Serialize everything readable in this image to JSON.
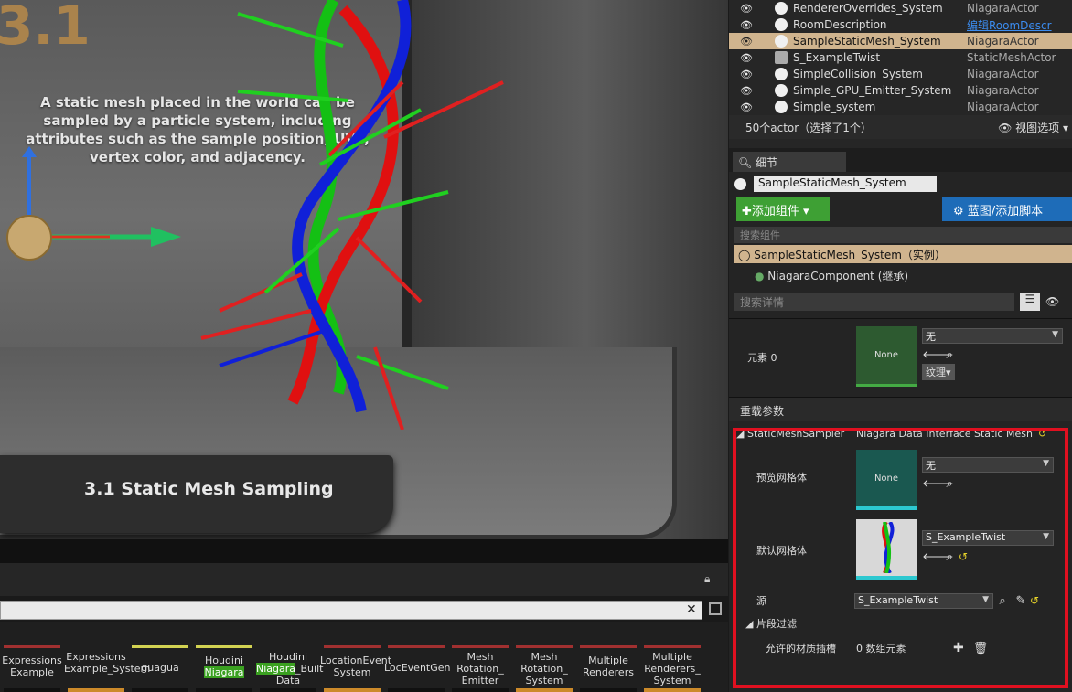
{
  "viewport": {
    "heading": "3.1",
    "description": "A static mesh placed in the world can be sampled by a particle system, including attributes such as the sample position, UVs, vertex color, and adjacency.",
    "plaque": "3.1  Static Mesh Sampling"
  },
  "content_browser": {
    "items": [
      {
        "label": "Expressions Example",
        "highlight": ""
      },
      {
        "label": "Expressions Example_System",
        "highlight": ""
      },
      {
        "label": "guagua",
        "highlight": ""
      },
      {
        "label_a": "Houdini",
        "label_b": "Niagara",
        "highlight": "Niagara"
      },
      {
        "label_a": "Houdini",
        "label_b": "Niagara",
        "label_c": "_Built Data",
        "highlight": "Niagara"
      },
      {
        "label": "LocationEvent System",
        "highlight": ""
      },
      {
        "label": "LocEventGen",
        "highlight": ""
      },
      {
        "label": "Mesh Rotation_ Emitter",
        "highlight": ""
      },
      {
        "label": "Mesh Rotation_ System",
        "highlight": ""
      },
      {
        "label": "Multiple Renderers",
        "highlight": ""
      },
      {
        "label": "Multiple Renderers_ System",
        "highlight": ""
      }
    ]
  },
  "outliner": {
    "rows": [
      {
        "name": "RendererOverrides_System",
        "type": "NiagaraActor",
        "selected": false,
        "link": false
      },
      {
        "name": "RoomDescription",
        "type": "编辑RoomDescr",
        "selected": false,
        "link": true
      },
      {
        "name": "SampleStaticMesh_System",
        "type": "NiagaraActor",
        "selected": true,
        "link": false
      },
      {
        "name": "S_ExampleTwist",
        "type": "StaticMeshActor",
        "selected": false,
        "link": false
      },
      {
        "name": "SimpleCollision_System",
        "type": "NiagaraActor",
        "selected": false,
        "link": false
      },
      {
        "name": "Simple_GPU_Emitter_System",
        "type": "NiagaraActor",
        "selected": false,
        "link": false
      },
      {
        "name": "Simple_system",
        "type": "NiagaraActor",
        "selected": false,
        "link": false
      }
    ],
    "count": "50个actor（选择了1个）",
    "view_options": "视图选项"
  },
  "details": {
    "tab": "细节",
    "actor_name": "SampleStaticMesh_System",
    "add_component": "添加组件",
    "blueprint": "蓝图/添加脚本",
    "search_components": "搜索组件",
    "component_root": "SampleStaticMesh_System（实例）",
    "component_child": "NiagaraComponent (继承)",
    "search_details": "搜索详情",
    "element0": "元素 0",
    "none": "None",
    "none_select": "无",
    "texture": "纹理",
    "override_params": "重载参数",
    "sampler_label": "StaticMeshSampler",
    "sampler_value": "Niagara Data Interface Static Mesh",
    "preview_mesh": "预览网格体",
    "default_mesh": "默认网格体",
    "default_mesh_value": "S_ExampleTwist",
    "source": "源",
    "source_value": "S_ExampleTwist",
    "section_filter": "片段过滤",
    "allowed_slots": "允许的材质插槽",
    "array_elements": "0 数组元素"
  }
}
